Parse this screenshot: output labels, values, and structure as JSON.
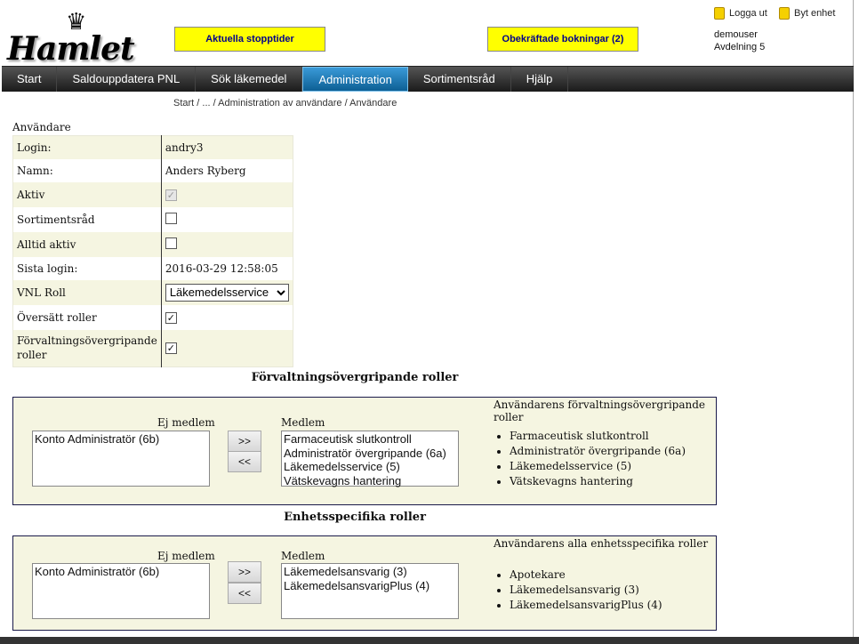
{
  "header": {
    "logo_text": "Hamlet",
    "btn_stopptider": "Aktuella stopptider",
    "btn_bokningar": "Obekräftade bokningar (2)",
    "logout": "Logga ut",
    "switch_unit": "Byt enhet",
    "username": "demouser",
    "unit": "Avdelning 5",
    "icons": {
      "lock": "lock-icon"
    }
  },
  "nav": {
    "tabs": [
      {
        "label": "Start"
      },
      {
        "label": "Saldouppdatera PNL"
      },
      {
        "label": "Sök läkemedel"
      },
      {
        "label": "Administration",
        "active": true
      },
      {
        "label": "Sortimentsråd"
      },
      {
        "label": "Hjälp"
      }
    ]
  },
  "breadcrumb": "Start / ... / Administration av användare / Användare",
  "user": {
    "section_title": "Användare",
    "login_label": "Login:",
    "login": "andry3",
    "name_label": "Namn:",
    "name": "Anders Ryberg",
    "active_label": "Aktiv",
    "active": true,
    "sort_label": "Sortimentsråd",
    "sort": false,
    "always_label": "Alltid aktiv",
    "always": false,
    "last_label": "Sista login:",
    "last_login": "2016-03-29 12:58:05",
    "vnl_label": "VNL Roll",
    "vnl_value": "Läkemedelsservice",
    "translate_label": "Översätt roller",
    "translate": true,
    "cross_label": "Förvaltningsövergripande roller",
    "cross": true
  },
  "cross_roles": {
    "title": "Förvaltningsövergripande roller",
    "non_member_label": "Ej medlem",
    "member_label": "Medlem",
    "non_members": [
      "Konto Administratör (6b)"
    ],
    "members": [
      "Farmaceutisk slutkontroll",
      "Administratör övergripande (6a)",
      "Läkemedelsservice (5)",
      "Vätskevagns hantering"
    ],
    "add": ">>",
    "remove": "<<",
    "summary_title": "Användarens förvaltningsövergripande roller",
    "summary": [
      "Farmaceutisk slutkontroll",
      "Administratör övergripande (6a)",
      "Läkemedelsservice (5)",
      "Vätskevagns hantering"
    ]
  },
  "unit_roles": {
    "title": "Enhetsspecifika roller",
    "non_member_label": "Ej medlem",
    "member_label": "Medlem",
    "non_members": [
      "Konto Administratör (6b)"
    ],
    "members": [
      "Läkemedelsansvarig (3)",
      "LäkemedelsansvarigPlus (4)"
    ],
    "add": ">>",
    "remove": "<<",
    "summary_title": "Användarens alla enhetsspecifika roller",
    "summary": [
      "Apotekare",
      "Läkemedelsansvarig (3)",
      "LäkemedelsansvarigPlus (4)"
    ]
  }
}
